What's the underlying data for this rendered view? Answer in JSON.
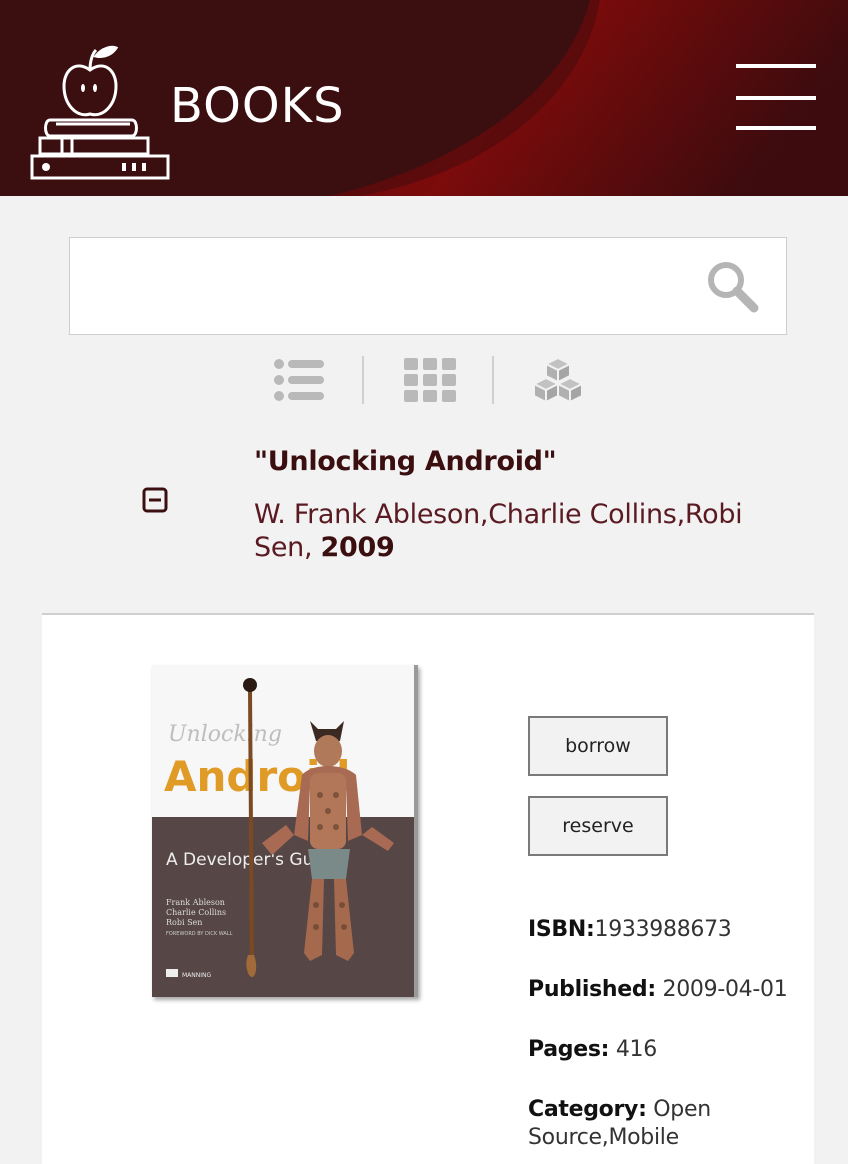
{
  "header": {
    "brand": "BOOKS",
    "logo_icon": "apple-on-books-icon",
    "menu_icon": "hamburger-menu-icon",
    "bg_color": "#3b0e10",
    "accent_color": "#8b0d0d"
  },
  "search": {
    "value": "",
    "placeholder": "",
    "icon": "search-icon"
  },
  "view_toggles": [
    {
      "icon": "list-view-icon"
    },
    {
      "icon": "grid-view-icon"
    },
    {
      "icon": "cubes-view-icon"
    }
  ],
  "result": {
    "collapse_icon": "minus-square-icon",
    "title": "\"Unlocking Android\"",
    "authors": "W. Frank Ableson,Charlie Collins,Robi Sen,",
    "year": "2009"
  },
  "detail": {
    "cover": {
      "title_line1": "Unlocking",
      "title_line2": "Android",
      "subtitle": "A Developer's Guide",
      "authors": [
        "Frank Ableson",
        "Charlie Collins",
        "Robi Sen"
      ],
      "foreword": "FOREWORD BY DICK WALL",
      "publisher": "MANNING"
    },
    "borrow_label": "borrow",
    "reserve_label": "reserve",
    "isbn_label": "ISBN:",
    "isbn": "1933988673",
    "published_label": "Published:",
    "published": " 2009-04-01",
    "pages_label": "Pages:",
    "pages": " 416",
    "category_label": "Category:",
    "category": " Open Source,Mobile"
  }
}
